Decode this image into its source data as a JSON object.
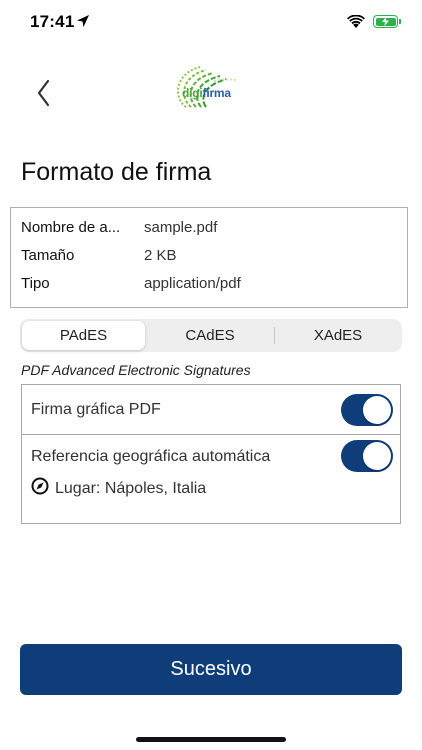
{
  "status_bar": {
    "time": "17:41"
  },
  "brand": {
    "logo_prefix": "digi",
    "logo_suffix": "firma"
  },
  "page": {
    "title": "Formato de firma"
  },
  "file_info": {
    "rows": [
      {
        "label": "Nombre de a...",
        "value": "sample.pdf"
      },
      {
        "label": "Tamaño",
        "value": "2 KB"
      },
      {
        "label": "Tipo",
        "value": "application/pdf"
      }
    ]
  },
  "tabs": [
    {
      "label": "PAdES",
      "selected": true
    },
    {
      "label": "CAdES",
      "selected": false
    },
    {
      "label": "XAdES",
      "selected": false
    }
  ],
  "section": {
    "subtitle": "PDF Advanced Electronic Signatures"
  },
  "options": [
    {
      "label": "Firma gráfica PDF",
      "enabled": true
    },
    {
      "label": "Referencia geográfica automática",
      "enabled": true,
      "location": "Lugar: Nápoles, Italia"
    }
  ],
  "actions": {
    "next_label": "Sucesivo"
  },
  "colors": {
    "primary": "#0f3d7a",
    "battery": "#2bb24c",
    "logo_green": "#4aa63a",
    "logo_blue": "#2a5da8"
  },
  "icons": [
    "location-arrow-icon",
    "wifi-icon",
    "battery-icon",
    "back-chevron-icon",
    "compass-icon"
  ]
}
